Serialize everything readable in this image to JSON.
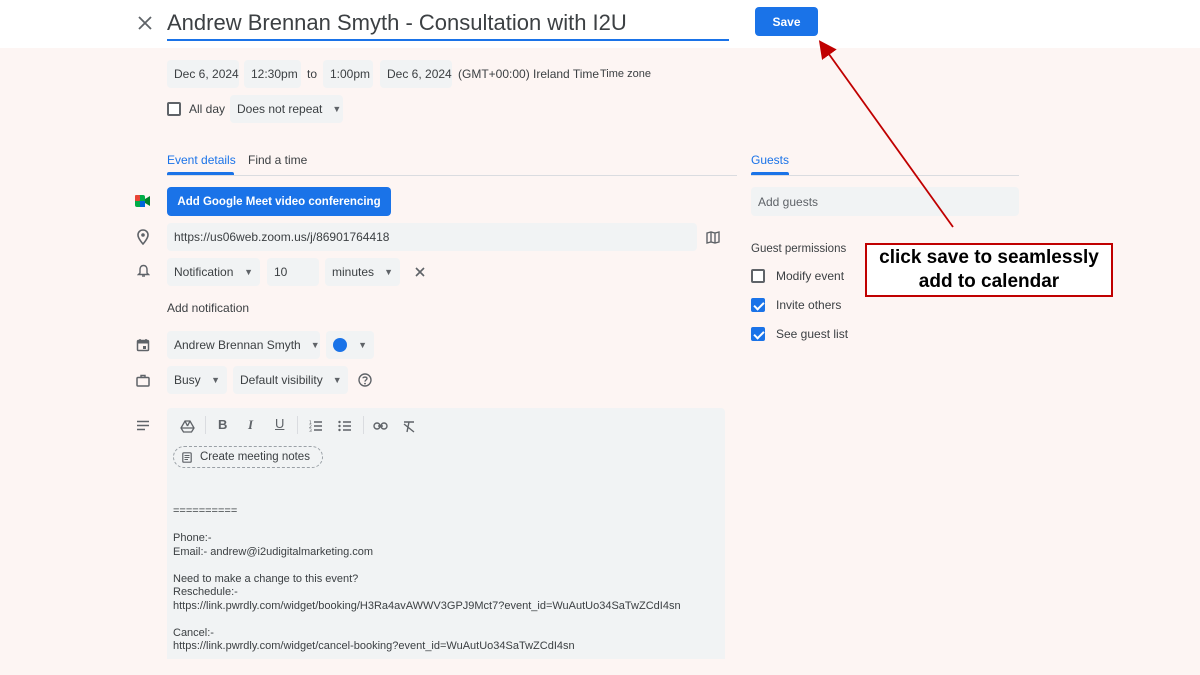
{
  "event": {
    "title": "Andrew Brennan Smyth - Consultation with I2U",
    "save_label": "Save",
    "start_date": "Dec 6, 2024",
    "start_time": "12:30pm",
    "to_label": "to",
    "end_time": "1:00pm",
    "end_date": "Dec 6, 2024",
    "timezone_label": "(GMT+00:00) Ireland Time",
    "timezone_link": "Time zone",
    "all_day_label": "All day",
    "repeat_value": "Does not repeat"
  },
  "tabs": [
    {
      "label": "Event details",
      "active": true
    },
    {
      "label": "Find a time",
      "active": false
    }
  ],
  "details": {
    "meet_button_label": "Add Google Meet video conferencing",
    "location_value": "https://us06web.zoom.us/j/86901764418",
    "notification_type": "Notification",
    "notification_amount": "10",
    "notification_unit": "minutes",
    "add_notification_label": "Add notification",
    "calendar_owner": "Andrew Brennan Smyth",
    "calendar_color": "#1a73e8",
    "availability": "Busy",
    "visibility": "Default visibility",
    "create_notes_label": "Create meeting notes",
    "description_lines": [
      "==========",
      "",
      "Phone:-",
      "Email:- andrew@i2udigitalmarketing.com",
      "",
      "Need to make a change to this event?",
      "Reschedule:-",
      "https://link.pwrdly.com/widget/booking/H3Ra4avAWWV3GPJ9Mct7?event_id=WuAutUo34SaTwZCdI4sn",
      "",
      "Cancel:-",
      "https://link.pwrdly.com/widget/cancel-booking?event_id=WuAutUo34SaTwZCdI4sn"
    ]
  },
  "guests": {
    "tab_label": "Guests",
    "add_placeholder": "Add guests",
    "permissions_label": "Guest permissions",
    "permissions": [
      {
        "label": "Modify event",
        "checked": false
      },
      {
        "label": "Invite others",
        "checked": true
      },
      {
        "label": "See guest list",
        "checked": true
      }
    ]
  },
  "annotation": {
    "line1": "click save to seamlessly",
    "line2": "add to calendar",
    "color": "#c00000"
  },
  "colors": {
    "accent": "#1a73e8"
  }
}
